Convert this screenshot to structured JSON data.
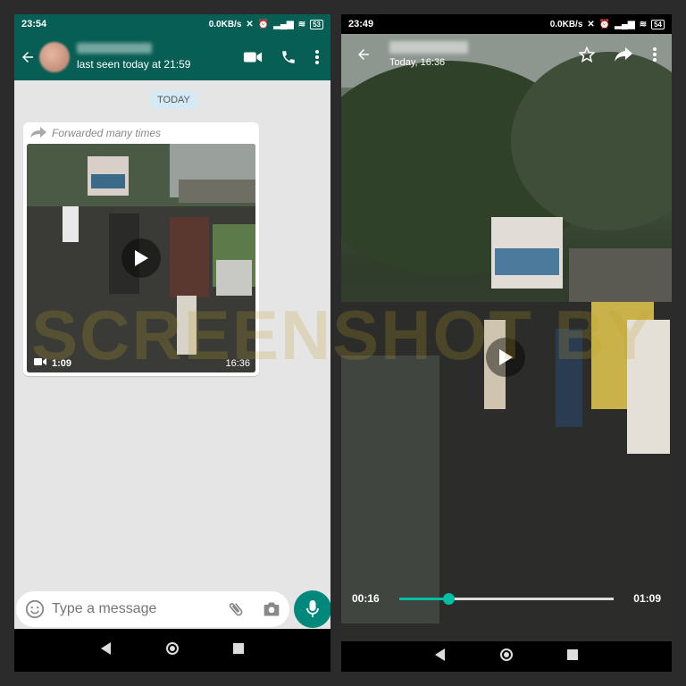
{
  "left": {
    "status": {
      "time": "23:54",
      "speed": "0.0KB/s",
      "battery": "53"
    },
    "header": {
      "last_seen": "last seen today at 21:59"
    },
    "date_chip": "TODAY",
    "message": {
      "forwarded": "Forwarded many times",
      "duration": "1:09",
      "time": "16:36"
    },
    "input": {
      "placeholder": "Type a message"
    }
  },
  "right": {
    "status": {
      "time": "23:49",
      "speed": "0.0KB/s",
      "battery": "54"
    },
    "header": {
      "subtitle": "Today, 16:36"
    },
    "player": {
      "elapsed": "00:16",
      "total": "01:09",
      "progress": 0.23
    }
  },
  "watermark": "SCREENSHOT BY",
  "colors": {
    "header": "#075e54",
    "accent": "#00897b",
    "seek": "#00bfa5",
    "date_chip": "#d4eaf4"
  },
  "icons": [
    "back-arrow-icon",
    "video-call-icon",
    "phone-icon",
    "more-vert-icon",
    "forward-icon",
    "play-icon",
    "video-camera-icon",
    "emoji-icon",
    "attach-icon",
    "camera-icon",
    "mic-icon",
    "star-icon",
    "share-icon",
    "nav-back-icon",
    "nav-home-icon",
    "nav-recents-icon"
  ]
}
